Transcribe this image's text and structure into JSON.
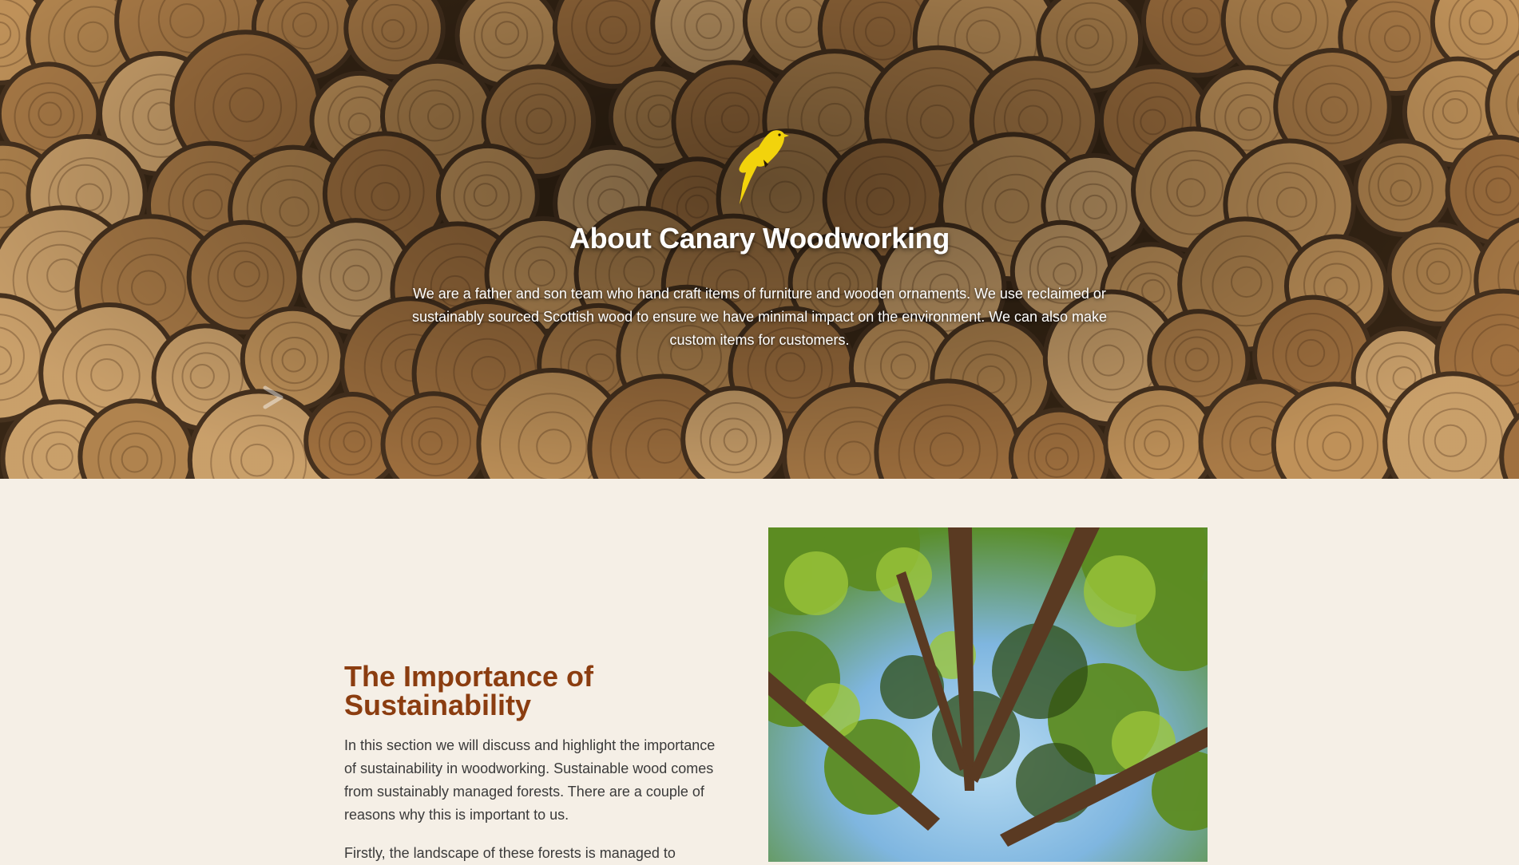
{
  "hero": {
    "title": "About Canary Woodworking",
    "text": "We are a father and son team who hand craft items of furniture and wooden ornaments. We use reclaimed or sustainably sourced Scottish wood to ensure we have minimal impact on the environment. We can also make custom items for customers.",
    "logo_icon": "canary-bird-icon",
    "arrow_icon": "chevron-right-icon",
    "logo_color": "#f2d30c"
  },
  "sustainability": {
    "title": "The Importance of Sustainability",
    "paragraphs": [
      "In this section we will discuss and highlight the importance of sustainability in woodworking. Sustainable wood comes from sustainably managed forests. There are a couple of reasons why this is important to us.",
      "Firstly, the landscape of these forests is managed to"
    ],
    "title_color": "#8b3d10"
  }
}
